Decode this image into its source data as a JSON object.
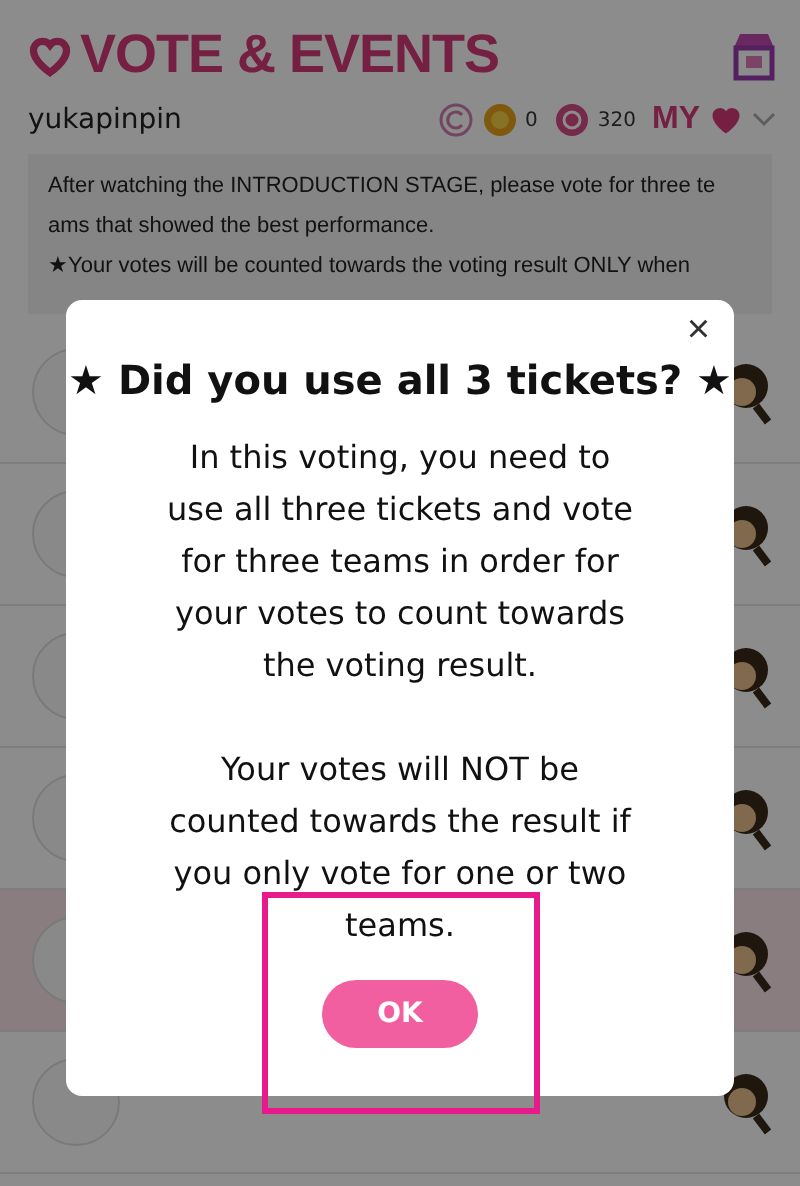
{
  "header": {
    "title": "VOTE & EVENTS"
  },
  "user_bar": {
    "username": "yukapinpin",
    "coin_gold": "0",
    "coin_pink": "320",
    "my_label": "MY"
  },
  "notice": {
    "lines": [
      "After watching the INTRODUCTION STAGE, please vote for three te",
      "ams that showed the best performance.",
      "★Your votes will be counted towards the voting result ONLY when"
    ]
  },
  "team_rows": [
    {
      "selected": false
    },
    {
      "selected": false
    },
    {
      "selected": false
    },
    {
      "selected": false
    },
    {
      "selected": true
    },
    {
      "selected": false
    }
  ],
  "dialog": {
    "close": "×",
    "title": "★ Did you use all 3 tickets? ★",
    "paragraphs": [
      [
        "In this voting, you need to",
        "use all three tickets and vote",
        "for three teams in order for",
        "your votes to count towards",
        "the voting result."
      ],
      [
        "Your votes will NOT be",
        "counted towards the result if",
        "you only vote for one or two",
        "teams."
      ]
    ],
    "ok_button": "OK"
  }
}
